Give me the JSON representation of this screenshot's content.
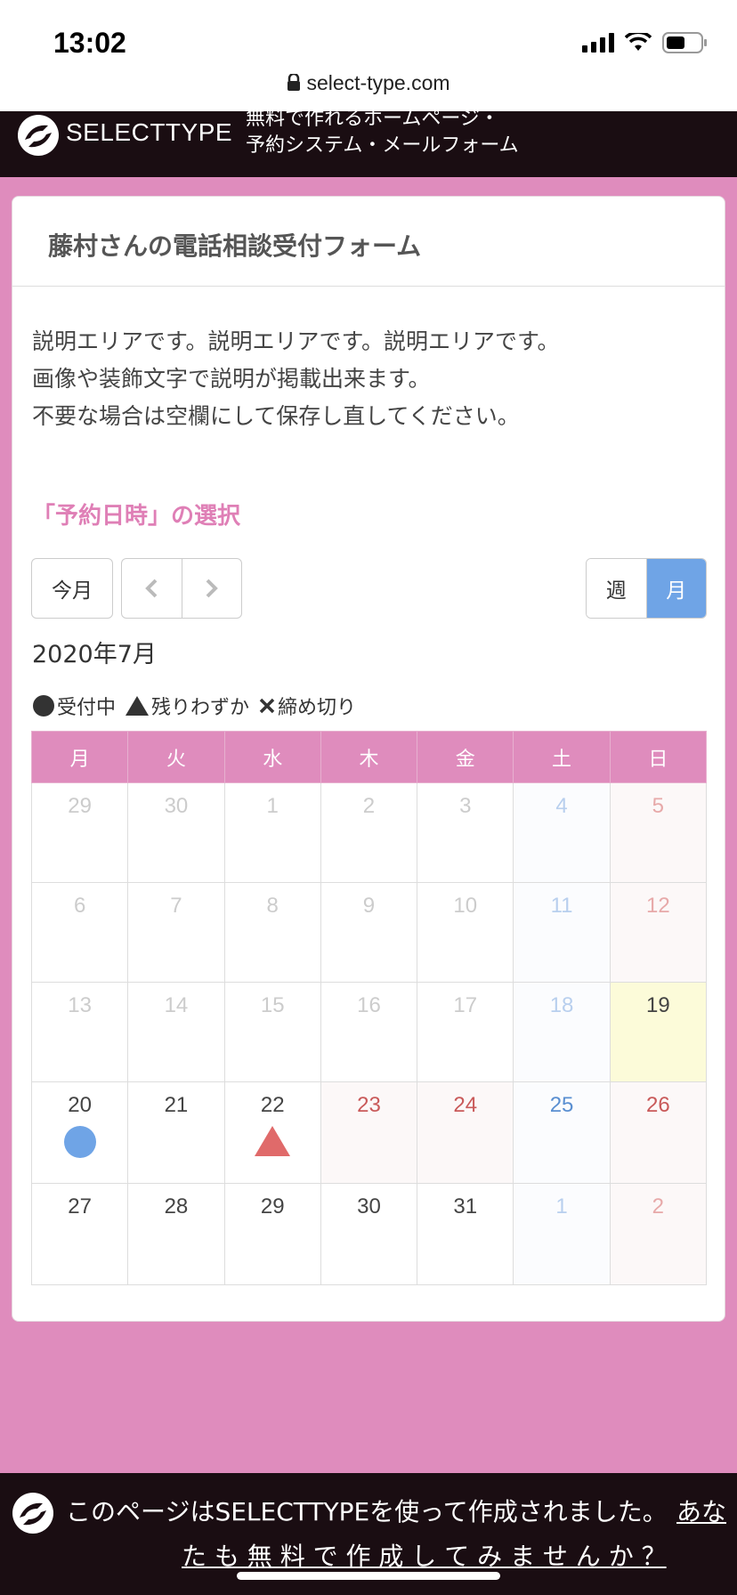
{
  "status": {
    "time": "13:02",
    "url": "select-type.com"
  },
  "brand": {
    "name": "SELECTTYPE",
    "tagline_line1": "無料で作れるホームページ・",
    "tagline_line2": "予約システム・メールフォーム"
  },
  "form": {
    "title": "藤村さんの電話相談受付フォーム",
    "description": [
      "説明エリアです。説明エリアです。説明エリアです。",
      "画像や装飾文字で説明が掲載出来ます。",
      "不要な場合は空欄にして保存し直してください。"
    ],
    "section_title": "「予約日時」の選択"
  },
  "calendar_controls": {
    "today_label": "今月",
    "prev_icon": "chevron-left-icon",
    "next_icon": "chevron-right-icon",
    "week_label": "週",
    "month_label": "月",
    "active_view": "月"
  },
  "month_title": "2020年7月",
  "legend": {
    "open": "受付中",
    "few": "残りわずか",
    "closed": "締め切り"
  },
  "weekdays": [
    "月",
    "火",
    "水",
    "木",
    "金",
    "土",
    "日"
  ],
  "weeks": [
    [
      "29",
      "30",
      "1",
      "2",
      "3",
      "4",
      "5"
    ],
    [
      "6",
      "7",
      "8",
      "9",
      "10",
      "11",
      "12"
    ],
    [
      "13",
      "14",
      "15",
      "16",
      "17",
      "18",
      "19"
    ],
    [
      "20",
      "21",
      "22",
      "23",
      "24",
      "25",
      "26"
    ],
    [
      "27",
      "28",
      "29",
      "30",
      "31",
      "1",
      "2"
    ]
  ],
  "colors": {
    "accent_pink": "#df8cbd",
    "open_blue": "#6fa4e6",
    "few_red": "#e06a6a",
    "holiday_red": "#c95a5a"
  },
  "footer": {
    "text": "このページはSELECTTYPEを使って作成されました。",
    "link_part1": "あな",
    "link_part2": "た も 無 料 で 作 成 し て み ま せ ん か ？"
  }
}
